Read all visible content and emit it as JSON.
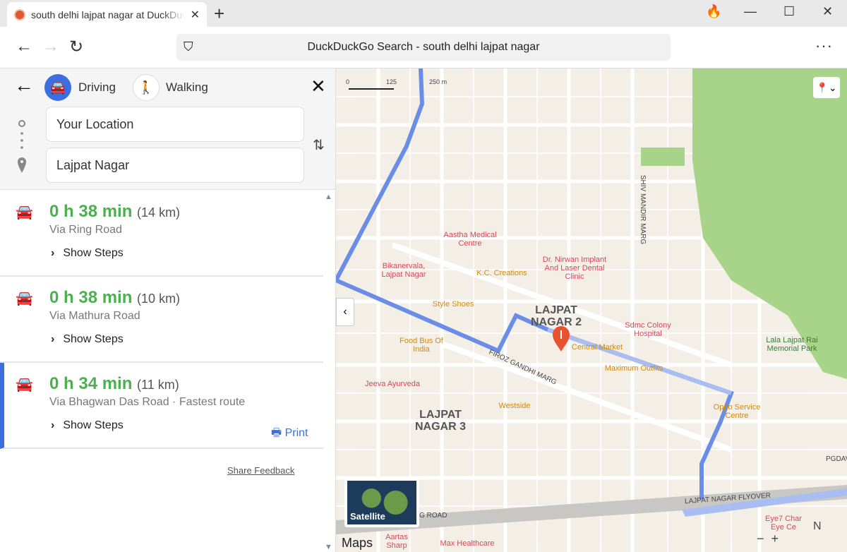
{
  "browser": {
    "tab_title": "south delhi lajpat nagar at DuckDuckGo",
    "address": "DuckDuckGo Search - south delhi lajpat nagar"
  },
  "directions": {
    "modes": [
      {
        "label": "Driving",
        "icon": "car-icon",
        "selected": true
      },
      {
        "label": "Walking",
        "icon": "walking-icon",
        "selected": false
      }
    ],
    "from": "Your Location",
    "to": "Lajpat Nagar",
    "routes": [
      {
        "duration": "0 h 38 min",
        "distance": "(14 km)",
        "via": "Via Ring Road",
        "steps": "Show Steps",
        "selected": false
      },
      {
        "duration": "0 h 38 min",
        "distance": "(10 km)",
        "via": "Via Mathura Road",
        "steps": "Show Steps",
        "selected": false
      },
      {
        "duration": "0 h 34 min",
        "distance": "(11 km)",
        "via": "Via Bhagwan Das Road · Fastest route",
        "steps": "Show Steps",
        "selected": true
      }
    ],
    "print": "Print",
    "feedback": "Share Feedback"
  },
  "map": {
    "scale": [
      "0",
      "125",
      "250 m"
    ],
    "satellite": "Satellite",
    "logo": "Maps",
    "route_color": "#3b6fe0",
    "park_color": "#a8d48a",
    "labels": [
      "Aastha Medical Centre",
      "Dr. Nirwan Implant And Laser Dental Clinic",
      "Bikanervala, Lajpat Nagar",
      "K.C. Creations",
      "Style Shoes",
      "LAJPAT NAGAR 2",
      "Sdmc Colony Hospital",
      "Food Bus Of India",
      "Central Market",
      "Maximum Outfits",
      "Jeeva Ayurveda",
      "Westside",
      "LAJPAT NAGAR 3",
      "Oppo Service Centre",
      "Lala Lajpat Rai Memorial Park",
      "SHIV MANDIR MARG",
      "FIROZ GANDHI MARG",
      "LAJPAT NAGAR FLYOVER",
      "G ROAD",
      "Aartas Sharp",
      "Max Healthcare",
      "Eye7 Char Eye Ce",
      "PGDAV"
    ]
  }
}
